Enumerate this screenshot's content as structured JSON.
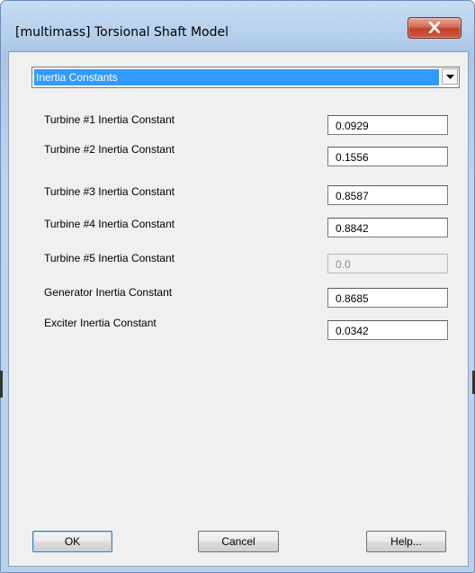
{
  "window": {
    "title": "[multimass] Torsional Shaft Model",
    "close_symbol": "✕"
  },
  "category_select": {
    "selected": "Inertia Constants"
  },
  "fields": [
    {
      "label": "Turbine #1 Inertia Constant",
      "value": "0.0929",
      "enabled": true
    },
    {
      "label": "Turbine #2 Inertia Constant",
      "value": "0.1556",
      "enabled": true
    },
    {
      "label": "Turbine #3 Inertia Constant",
      "value": "0.8587",
      "enabled": true
    },
    {
      "label": "Turbine #4 Inertia Constant",
      "value": "0.8842",
      "enabled": true
    },
    {
      "label": "Turbine #5 Inertia Constant",
      "value": "0.0",
      "enabled": false
    },
    {
      "label": "Generator Inertia Constant",
      "value": "0.8685",
      "enabled": true
    },
    {
      "label": "Exciter Inertia Constant",
      "value": "0.0342",
      "enabled": true
    }
  ],
  "buttons": {
    "ok": "OK",
    "cancel": "Cancel",
    "help": "Help..."
  },
  "colors": {
    "selection_highlight": "#3399ff",
    "close_button": "#c9503a",
    "window_frame": "#b9d2ec"
  }
}
